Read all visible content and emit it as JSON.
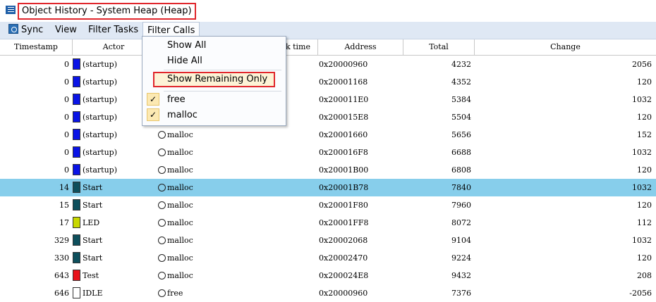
{
  "window": {
    "title": "Object History - System Heap (Heap)"
  },
  "menu": {
    "sync": "Sync",
    "view": "View",
    "filter_tasks": "Filter Tasks",
    "filter_calls": "Filter Calls"
  },
  "dropdown": {
    "show_all": "Show All",
    "hide_all": "Hide All",
    "show_remaining_only": "Show Remaining Only",
    "items": [
      {
        "label": "free",
        "checked": true
      },
      {
        "label": "malloc",
        "checked": true
      }
    ]
  },
  "columns": {
    "timestamp": "Timestamp",
    "actor": "Actor",
    "call_partial": "k time",
    "address": "Address",
    "total": "Total",
    "change": "Change"
  },
  "rows": [
    {
      "ts": "0",
      "color": "#0a14e6",
      "actor": "(startup)",
      "call": "",
      "addr": "0x20000960",
      "total": "4232",
      "change": "2056"
    },
    {
      "ts": "0",
      "color": "#0a14e6",
      "actor": "(startup)",
      "call": "",
      "addr": "0x20001168",
      "total": "4352",
      "change": "120"
    },
    {
      "ts": "0",
      "color": "#0a14e6",
      "actor": "(startup)",
      "call": "",
      "addr": "0x200011E0",
      "total": "5384",
      "change": "1032"
    },
    {
      "ts": "0",
      "color": "#0a14e6",
      "actor": "(startup)",
      "call": "",
      "addr": "0x200015E8",
      "total": "5504",
      "change": "120"
    },
    {
      "ts": "0",
      "color": "#0a14e6",
      "actor": "(startup)",
      "call": "malloc",
      "addr": "0x20001660",
      "total": "5656",
      "change": "152"
    },
    {
      "ts": "0",
      "color": "#0a14e6",
      "actor": "(startup)",
      "call": "malloc",
      "addr": "0x200016F8",
      "total": "6688",
      "change": "1032"
    },
    {
      "ts": "0",
      "color": "#0a14e6",
      "actor": "(startup)",
      "call": "malloc",
      "addr": "0x20001B00",
      "total": "6808",
      "change": "120"
    },
    {
      "ts": "14",
      "color": "#0e4f5c",
      "actor": "Start",
      "call": "malloc",
      "addr": "0x20001B78",
      "total": "7840",
      "change": "1032",
      "selected": true
    },
    {
      "ts": "15",
      "color": "#0e4f5c",
      "actor": "Start",
      "call": "malloc",
      "addr": "0x20001F80",
      "total": "7960",
      "change": "120"
    },
    {
      "ts": "17",
      "color": "#c8d800",
      "actor": "LED",
      "call": "malloc",
      "addr": "0x20001FF8",
      "total": "8072",
      "change": "112"
    },
    {
      "ts": "329",
      "color": "#0e4f5c",
      "actor": "Start",
      "call": "malloc",
      "addr": "0x20002068",
      "total": "9104",
      "change": "1032"
    },
    {
      "ts": "330",
      "color": "#0e4f5c",
      "actor": "Start",
      "call": "malloc",
      "addr": "0x20002470",
      "total": "9224",
      "change": "120"
    },
    {
      "ts": "643",
      "color": "#e8131a",
      "actor": "Test",
      "call": "malloc",
      "addr": "0x200024E8",
      "total": "9432",
      "change": "208"
    },
    {
      "ts": "646",
      "color": "#ffffff",
      "actor": "IDLE",
      "call": "free",
      "addr": "0x20000960",
      "total": "7376",
      "change": "-2056"
    }
  ]
}
